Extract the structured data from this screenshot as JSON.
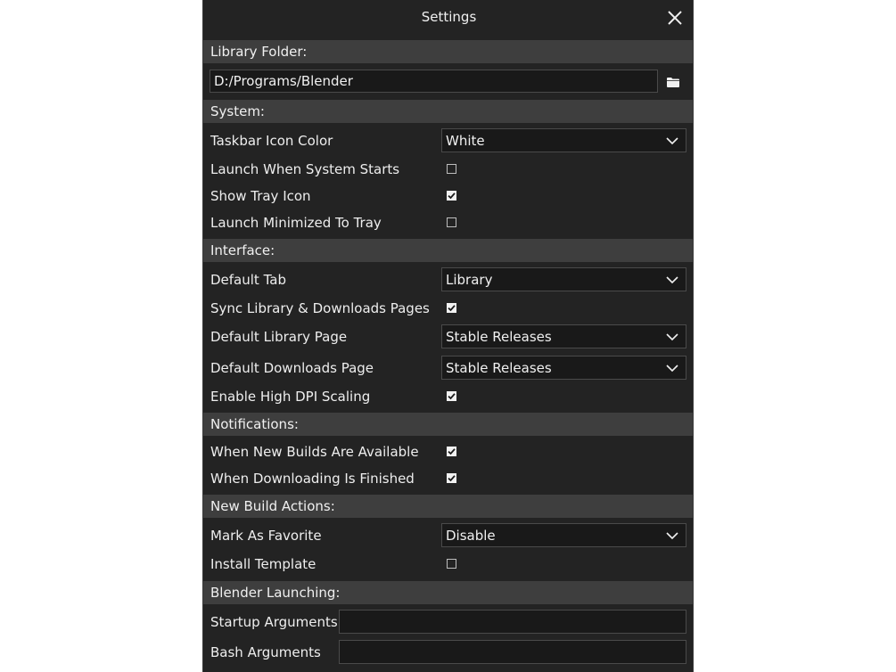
{
  "title": "Settings",
  "sections": {
    "library_folder": "Library Folder:",
    "system": "System:",
    "interface": "Interface:",
    "notifications": "Notifications:",
    "new_build_actions": "New Build Actions:",
    "blender_launching": "Blender Launching:"
  },
  "library_folder": {
    "path": "D:/Programs/Blender"
  },
  "system": {
    "taskbar_icon_color": {
      "label": "Taskbar Icon Color",
      "value": "White"
    },
    "launch_on_startup": {
      "label": "Launch When System Starts",
      "checked": false
    },
    "show_tray_icon": {
      "label": "Show Tray Icon",
      "checked": true
    },
    "launch_minimized": {
      "label": "Launch Minimized To Tray",
      "checked": false
    }
  },
  "interface": {
    "default_tab": {
      "label": "Default Tab",
      "value": "Library"
    },
    "sync_pages": {
      "label": "Sync Library & Downloads Pages",
      "checked": true
    },
    "default_library_page": {
      "label": "Default Library Page",
      "value": "Stable Releases"
    },
    "default_downloads_page": {
      "label": "Default Downloads Page",
      "value": "Stable Releases"
    },
    "high_dpi": {
      "label": "Enable High DPI Scaling",
      "checked": true
    }
  },
  "notifications": {
    "new_builds": {
      "label": "When New Builds Are Available",
      "checked": true
    },
    "download_finished": {
      "label": "When Downloading Is Finished",
      "checked": true
    }
  },
  "new_build_actions": {
    "mark_favorite": {
      "label": "Mark As Favorite",
      "value": "Disable"
    },
    "install_template": {
      "label": "Install Template",
      "checked": false
    }
  },
  "blender_launching": {
    "startup_args": {
      "label": "Startup Arguments",
      "value": ""
    },
    "bash_args": {
      "label": "Bash Arguments",
      "value": ""
    }
  },
  "icons": {
    "close": "close-icon",
    "folder": "folder-icon",
    "dropdown": "chevron-down-icon",
    "check": "checkmark-icon"
  },
  "colors": {
    "window_bg": "#232323",
    "section_bg": "#3e3e3e",
    "field_bg": "#191919",
    "text": "#eeeeee"
  }
}
